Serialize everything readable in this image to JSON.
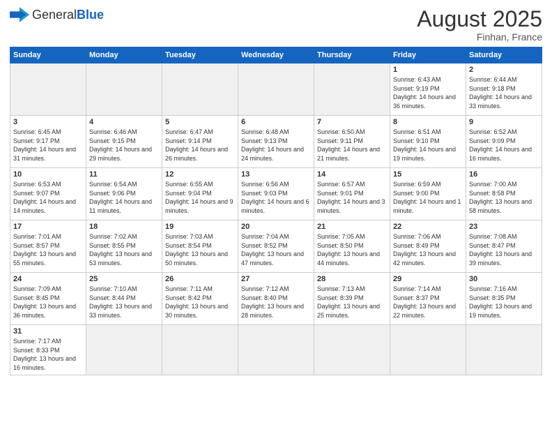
{
  "header": {
    "logo_general": "General",
    "logo_blue": "Blue",
    "month_year": "August 2025",
    "location": "Finhan, France"
  },
  "weekdays": [
    "Sunday",
    "Monday",
    "Tuesday",
    "Wednesday",
    "Thursday",
    "Friday",
    "Saturday"
  ],
  "weeks": [
    [
      {
        "day": "",
        "info": "",
        "empty": true
      },
      {
        "day": "",
        "info": "",
        "empty": true
      },
      {
        "day": "",
        "info": "",
        "empty": true
      },
      {
        "day": "",
        "info": "",
        "empty": true
      },
      {
        "day": "",
        "info": "",
        "empty": true
      },
      {
        "day": "1",
        "info": "Sunrise: 6:43 AM\nSunset: 9:19 PM\nDaylight: 14 hours and 36 minutes."
      },
      {
        "day": "2",
        "info": "Sunrise: 6:44 AM\nSunset: 9:18 PM\nDaylight: 14 hours and 33 minutes."
      }
    ],
    [
      {
        "day": "3",
        "info": "Sunrise: 6:45 AM\nSunset: 9:17 PM\nDaylight: 14 hours and 31 minutes."
      },
      {
        "day": "4",
        "info": "Sunrise: 6:46 AM\nSunset: 9:15 PM\nDaylight: 14 hours and 29 minutes."
      },
      {
        "day": "5",
        "info": "Sunrise: 6:47 AM\nSunset: 9:14 PM\nDaylight: 14 hours and 26 minutes."
      },
      {
        "day": "6",
        "info": "Sunrise: 6:48 AM\nSunset: 9:13 PM\nDaylight: 14 hours and 24 minutes."
      },
      {
        "day": "7",
        "info": "Sunrise: 6:50 AM\nSunset: 9:11 PM\nDaylight: 14 hours and 21 minutes."
      },
      {
        "day": "8",
        "info": "Sunrise: 6:51 AM\nSunset: 9:10 PM\nDaylight: 14 hours and 19 minutes."
      },
      {
        "day": "9",
        "info": "Sunrise: 6:52 AM\nSunset: 9:09 PM\nDaylight: 14 hours and 16 minutes."
      }
    ],
    [
      {
        "day": "10",
        "info": "Sunrise: 6:53 AM\nSunset: 9:07 PM\nDaylight: 14 hours and 14 minutes."
      },
      {
        "day": "11",
        "info": "Sunrise: 6:54 AM\nSunset: 9:06 PM\nDaylight: 14 hours and 11 minutes."
      },
      {
        "day": "12",
        "info": "Sunrise: 6:55 AM\nSunset: 9:04 PM\nDaylight: 14 hours and 9 minutes."
      },
      {
        "day": "13",
        "info": "Sunrise: 6:56 AM\nSunset: 9:03 PM\nDaylight: 14 hours and 6 minutes."
      },
      {
        "day": "14",
        "info": "Sunrise: 6:57 AM\nSunset: 9:01 PM\nDaylight: 14 hours and 3 minutes."
      },
      {
        "day": "15",
        "info": "Sunrise: 6:59 AM\nSunset: 9:00 PM\nDaylight: 14 hours and 1 minute."
      },
      {
        "day": "16",
        "info": "Sunrise: 7:00 AM\nSunset: 8:58 PM\nDaylight: 13 hours and 58 minutes."
      }
    ],
    [
      {
        "day": "17",
        "info": "Sunrise: 7:01 AM\nSunset: 8:57 PM\nDaylight: 13 hours and 55 minutes."
      },
      {
        "day": "18",
        "info": "Sunrise: 7:02 AM\nSunset: 8:55 PM\nDaylight: 13 hours and 53 minutes."
      },
      {
        "day": "19",
        "info": "Sunrise: 7:03 AM\nSunset: 8:54 PM\nDaylight: 13 hours and 50 minutes."
      },
      {
        "day": "20",
        "info": "Sunrise: 7:04 AM\nSunset: 8:52 PM\nDaylight: 13 hours and 47 minutes."
      },
      {
        "day": "21",
        "info": "Sunrise: 7:05 AM\nSunset: 8:50 PM\nDaylight: 13 hours and 44 minutes."
      },
      {
        "day": "22",
        "info": "Sunrise: 7:06 AM\nSunset: 8:49 PM\nDaylight: 13 hours and 42 minutes."
      },
      {
        "day": "23",
        "info": "Sunrise: 7:08 AM\nSunset: 8:47 PM\nDaylight: 13 hours and 39 minutes."
      }
    ],
    [
      {
        "day": "24",
        "info": "Sunrise: 7:09 AM\nSunset: 8:45 PM\nDaylight: 13 hours and 36 minutes."
      },
      {
        "day": "25",
        "info": "Sunrise: 7:10 AM\nSunset: 8:44 PM\nDaylight: 13 hours and 33 minutes."
      },
      {
        "day": "26",
        "info": "Sunrise: 7:11 AM\nSunset: 8:42 PM\nDaylight: 13 hours and 30 minutes."
      },
      {
        "day": "27",
        "info": "Sunrise: 7:12 AM\nSunset: 8:40 PM\nDaylight: 13 hours and 28 minutes."
      },
      {
        "day": "28",
        "info": "Sunrise: 7:13 AM\nSunset: 8:39 PM\nDaylight: 13 hours and 25 minutes."
      },
      {
        "day": "29",
        "info": "Sunrise: 7:14 AM\nSunset: 8:37 PM\nDaylight: 13 hours and 22 minutes."
      },
      {
        "day": "30",
        "info": "Sunrise: 7:16 AM\nSunset: 8:35 PM\nDaylight: 13 hours and 19 minutes."
      }
    ],
    [
      {
        "day": "31",
        "info": "Sunrise: 7:17 AM\nSunset: 8:33 PM\nDaylight: 13 hours and 16 minutes.",
        "last": true
      },
      {
        "day": "",
        "info": "",
        "empty": true,
        "last": true
      },
      {
        "day": "",
        "info": "",
        "empty": true,
        "last": true
      },
      {
        "day": "",
        "info": "",
        "empty": true,
        "last": true
      },
      {
        "day": "",
        "info": "",
        "empty": true,
        "last": true
      },
      {
        "day": "",
        "info": "",
        "empty": true,
        "last": true
      },
      {
        "day": "",
        "info": "",
        "empty": true,
        "last": true
      }
    ]
  ]
}
